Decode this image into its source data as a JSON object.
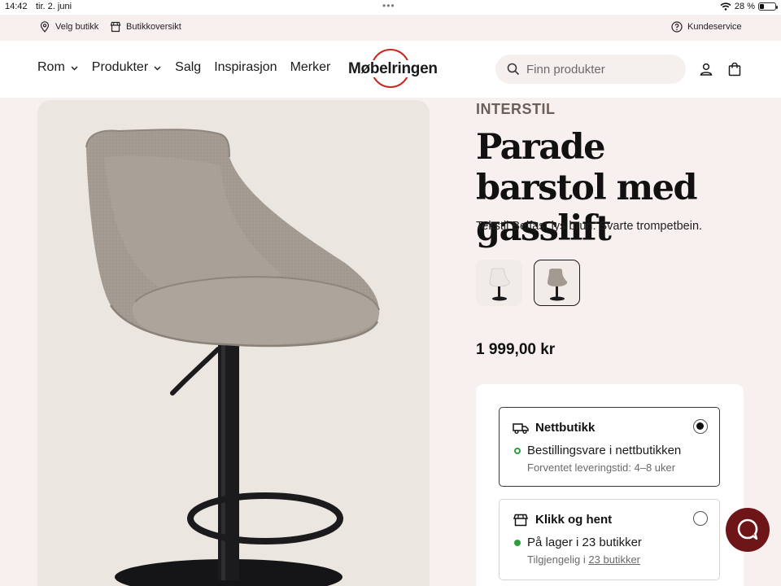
{
  "statusbar": {
    "time": "14:42",
    "date": "tir. 2. juni",
    "battery": "28 %",
    "battery_level": 0.28
  },
  "utility": {
    "store_select": "Velg butikk",
    "store_overview": "Butikkoversikt",
    "customer_service": "Kundeservice"
  },
  "nav": {
    "items": [
      {
        "label": "Rom",
        "has_dropdown": true
      },
      {
        "label": "Produkter",
        "has_dropdown": true
      },
      {
        "label": "Salg",
        "has_dropdown": false
      },
      {
        "label": "Inspirasjon",
        "has_dropdown": false
      },
      {
        "label": "Merker",
        "has_dropdown": false
      }
    ]
  },
  "logo": {
    "text": "Møbelringen"
  },
  "search": {
    "placeholder": "Finn produkter"
  },
  "product": {
    "brand": "INTERSTIL",
    "title": "Parade barstol med gasslift",
    "subtitle": "Tekstil Belfast lys brun. Svarte trompetbein.",
    "price": "1 999,00 kr",
    "variants": [
      {
        "name": "white-variant",
        "color": "#e9e5e2",
        "selected": false
      },
      {
        "name": "light-brown-variant",
        "color": "#a39a92",
        "selected": true
      }
    ]
  },
  "delivery": {
    "online": {
      "title": "Nettbutikk",
      "status": "Bestillingsvare i nettbutikken",
      "detail": "Forventet leveringstid: 4–8 uker",
      "selected": true
    },
    "click_collect": {
      "title": "Klikk og hent",
      "status": "På lager i 23 butikker",
      "detail_prefix": "Tilgjengelig i ",
      "detail_link": "23 butikker",
      "selected": false
    }
  },
  "colors": {
    "accent": "#c8281e",
    "chat": "#6e1518",
    "in_stock": "#2e9e3c",
    "chair_fabric": "#a39a92",
    "chair_frame": "#1b1b1d"
  }
}
